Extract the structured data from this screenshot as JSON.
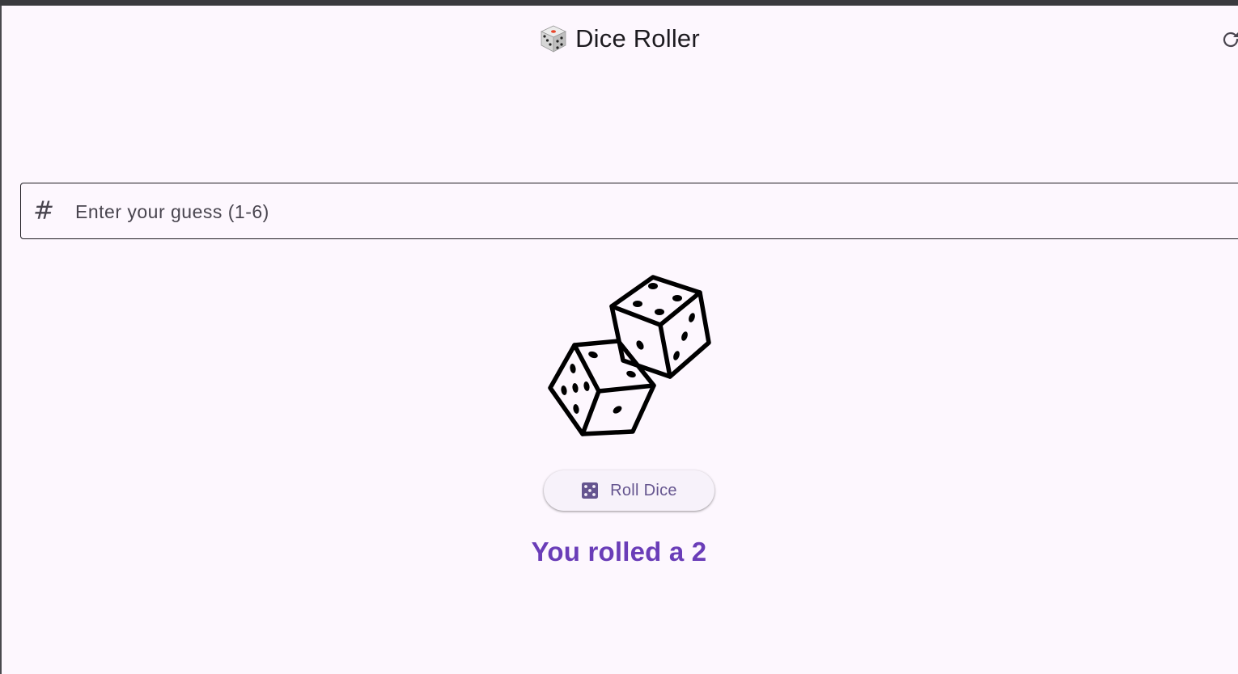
{
  "app_bar": {
    "title": "Dice Roller",
    "title_icon": "game-die-icon",
    "refresh_icon": "refresh-icon"
  },
  "guess_input": {
    "prefix_icon": "hash-icon",
    "placeholder": "Enter your guess (1-6)",
    "value": ""
  },
  "dice_image": {
    "icon": "two-dice-icon"
  },
  "roll_button": {
    "label": "Roll Dice",
    "icon": "dice-five-icon"
  },
  "result": {
    "text": "You rolled a 2"
  },
  "colors": {
    "background": "#FDF7FE",
    "primary": "#6A3DB8",
    "button_text": "#65558F",
    "button_bg": "#F7F2FA",
    "text": "#1D1B20"
  }
}
